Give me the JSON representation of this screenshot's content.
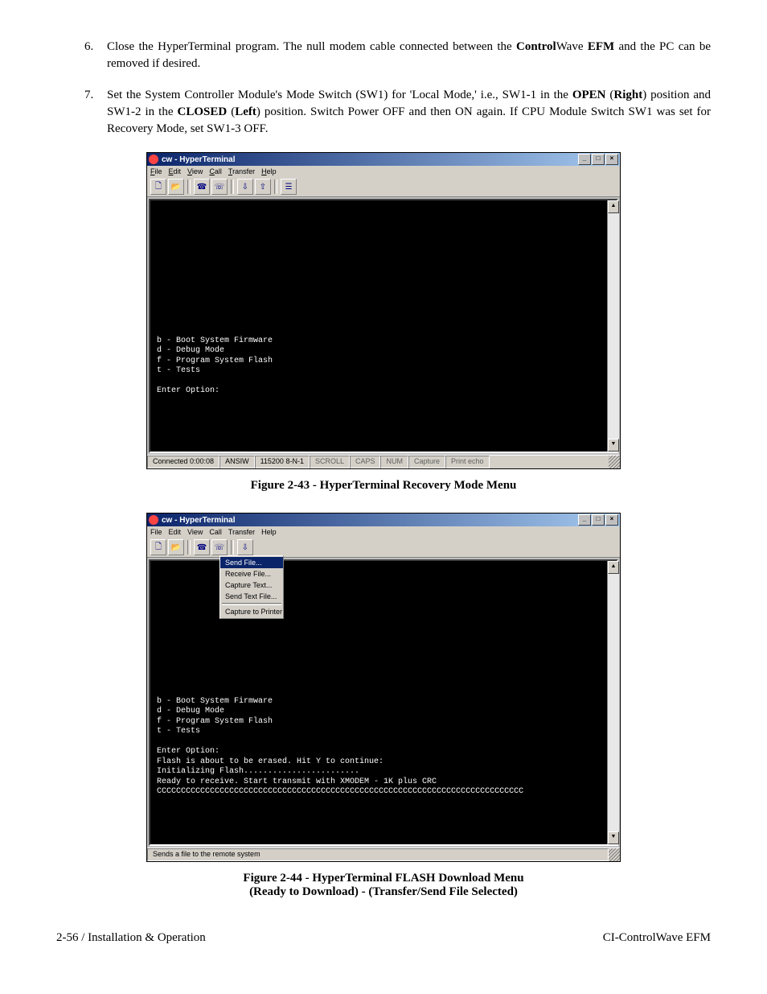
{
  "steps": {
    "s6num": "6.",
    "s6a": "Close the HyperTerminal program. The null modem cable connected between the ",
    "s6b": "Control",
    "s6c": "Wave ",
    "s6d": "EFM",
    "s6e": " and the PC can be removed if desired.",
    "s7num": "7.",
    "s7a": "Set the System Controller Module's Mode Switch (SW1) for 'Local Mode,' i.e., SW1-1 in the ",
    "s7b": "OPEN",
    "s7c": " (",
    "s7d": "Right",
    "s7e": ") position and SW1-2 in the ",
    "s7f": "CLOSED",
    "s7g": " (",
    "s7h": "Left",
    "s7i": ") position. Switch Power OFF and then ON again. If CPU Module Switch SW1 was set for Recovery Mode, set  SW1-3 OFF."
  },
  "win": {
    "title": "cw - HyperTerminal",
    "menu": {
      "file": "File",
      "edit": "Edit",
      "view": "View",
      "call": "Call",
      "transfer": "Transfer",
      "help": "Help"
    },
    "dropdown": {
      "sendfile": "Send File...",
      "recvfile": "Receive File...",
      "captext": "Capture Text...",
      "sendtext": "Send Text File...",
      "captprn": "Capture to Printer"
    },
    "status": {
      "conn": "Connected 0:00:08",
      "emu": "ANSIW",
      "baud": "115200 8-N-1",
      "scroll": "SCROLL",
      "caps": "CAPS",
      "num": "NUM",
      "capture": "Capture",
      "echo": "Print echo",
      "help2": "Sends a file to the remote system"
    }
  },
  "terminal1": "\n\n\n\n\n\n\n\n\n\n\n\n\nb - Boot System Firmware\nd - Debug Mode\nf - Program System Flash\nt - Tests\n\nEnter Option:",
  "terminal2": "\n\n\n\n\n\n\n\n\n\n\n\n\nb - Boot System Firmware\nd - Debug Mode\nf - Program System Flash\nt - Tests\n\nEnter Option:\nFlash is about to be erased. Hit Y to continue:\nInitializing Flash........................\nReady to receive. Start transmit with XMODEM - 1K plus CRC\nCCCCCCCCCCCCCCCCCCCCCCCCCCCCCCCCCCCCCCCCCCCCCCCCCCCCCCCCCCCCCCCCCCCCCCCCCCCC",
  "cap1": "Figure 2-43 - HyperTerminal Recovery Mode Menu",
  "cap2a": "Figure 2-44 - HyperTerminal FLASH Download Menu",
  "cap2b": "(Ready to Download) - (Transfer/Send File Selected)",
  "footer": {
    "left": "2-56 / Installation & Operation",
    "right": "CI-ControlWave EFM"
  }
}
